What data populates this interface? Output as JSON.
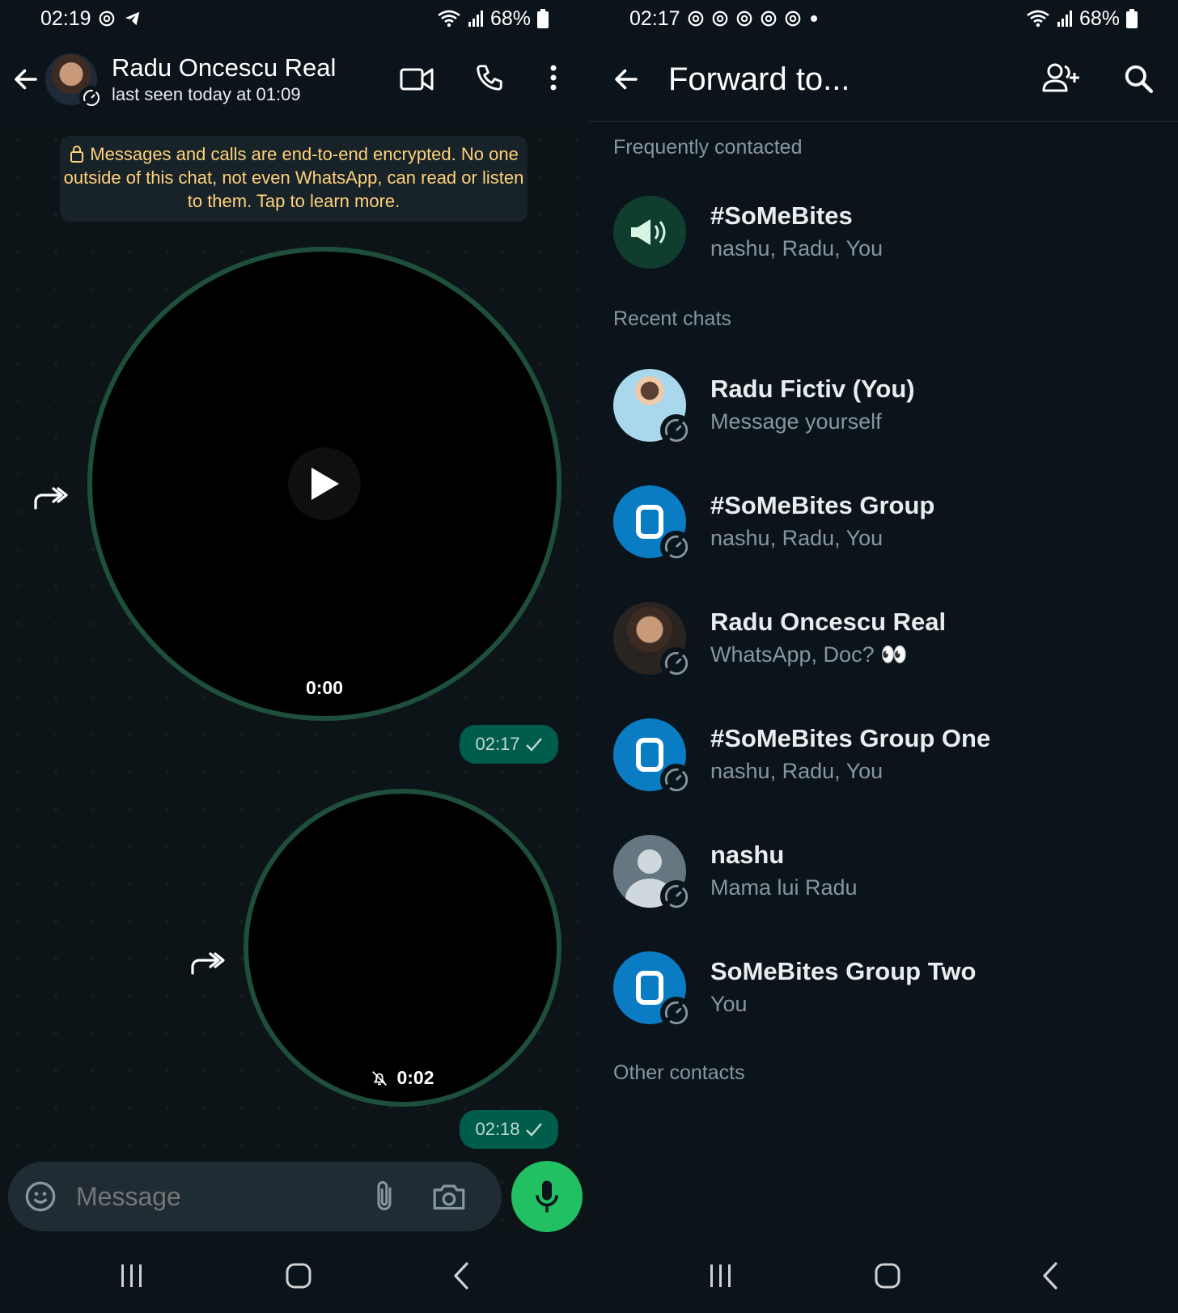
{
  "left": {
    "status_bar": {
      "time": "02:19",
      "battery": "68%"
    },
    "header": {
      "title": "Radu Oncescu Real",
      "subtitle": "last seen today at 01:09"
    },
    "encryption_notice": "Messages and calls are end-to-end encrypted. No one outside of this chat, not even WhatsApp, can read or listen to them. Tap to learn more.",
    "messages": [
      {
        "duration": "0:00",
        "time": "02:17"
      },
      {
        "duration": "0:02",
        "time": "02:18"
      }
    ],
    "composer": {
      "placeholder": "Message"
    }
  },
  "right": {
    "status_bar": {
      "time": "02:17",
      "battery": "68%"
    },
    "header": {
      "title": "Forward to..."
    },
    "sections": {
      "frequent": "Frequently contacted",
      "recent": "Recent chats",
      "other": "Other contacts"
    },
    "frequent": [
      {
        "name": "#SoMeBites",
        "sub": "nashu, Radu, You"
      }
    ],
    "recent": [
      {
        "name": "Radu Fictiv (You)",
        "sub": "Message yourself"
      },
      {
        "name": "#SoMeBites Group",
        "sub": "nashu, Radu, You"
      },
      {
        "name": "Radu Oncescu Real",
        "sub": "WhatsApp, Doc? 👀"
      },
      {
        "name": "#SoMeBites Group One",
        "sub": "nashu, Radu, You"
      },
      {
        "name": "nashu",
        "sub": "Mama lui Radu"
      },
      {
        "name": "SoMeBites Group Two",
        "sub": "You"
      }
    ]
  },
  "colors": {
    "accent": "#21c063",
    "bubble": "#005c4b",
    "notice_text": "#ffd279",
    "background": "#0b141a"
  }
}
